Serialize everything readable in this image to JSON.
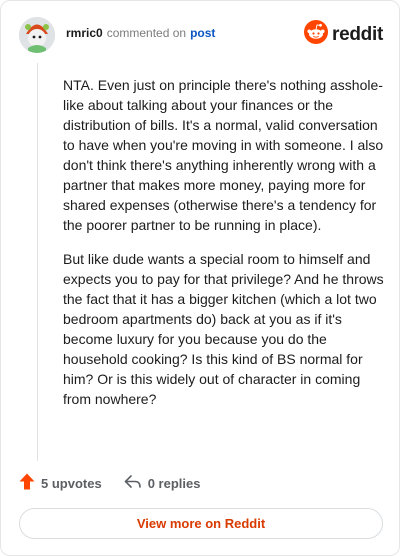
{
  "header": {
    "username": "rmric0",
    "verb": "commented on",
    "post_link": "post",
    "brand": "reddit"
  },
  "comment": {
    "paragraphs": [
      "NTA. Even just on principle there's nothing asshole-like about talking about your finances or the distribution of bills. It's a normal, valid conversation to have when you're moving in with someone. I also don't think there's anything inherently wrong with a partner that makes more money, paying more for shared expenses (otherwise there's a tendency for the poorer partner to be running in place).",
      "But like dude wants a special room to himself and expects you to pay for that privilege? And he throws the fact that it has a bigger kitchen (which a lot two bedroom apartments do) back at you as if it's become luxury for you because you do the household cooking? Is this kind of BS normal for him? Or is this widely out of character in coming from nowhere?"
    ]
  },
  "actions": {
    "upvotes": "5 upvotes",
    "replies": "0 replies"
  },
  "view_more": "View more on Reddit",
  "colors": {
    "accent": "#ff4500",
    "link": "#0b56c2",
    "cta": "#d93a00"
  }
}
